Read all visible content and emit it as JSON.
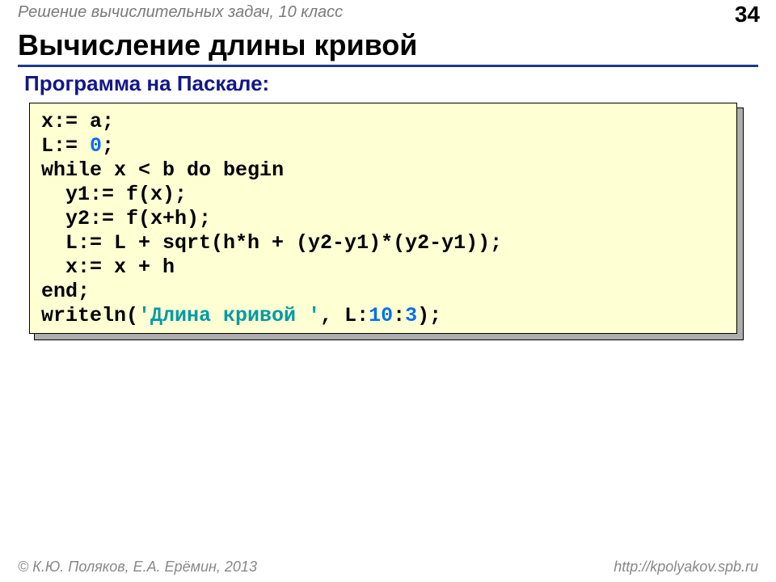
{
  "header": {
    "course": "Решение вычислительных задач, 10 класс",
    "page": "34"
  },
  "title": "Вычисление длины кривой",
  "subtitle": "Программа на Паскале:",
  "code": {
    "l1a": "x:= a;",
    "l2a": "L:= ",
    "l2b": "0",
    "l2c": ";",
    "l3a": "while",
    "l3b": " x < b ",
    "l3c": "do begin",
    "l4": "  y1:= f(x);",
    "l5": "  y2:= f(x+h);",
    "l6": "  L:= L + sqrt(h*h + (y2-y1)*(y2-y1));",
    "l7": "  x:= x + h",
    "l8": "end",
    "l8b": ";",
    "l9a": "writeln(",
    "l9b": "'Длина кривой '",
    "l9c": ", L:",
    "l9d": "10",
    "l9e": ":",
    "l9f": "3",
    "l9g": ");"
  },
  "footer": {
    "copyright": "© К.Ю. Поляков, Е.А. Ерёмин, 2013",
    "url": "http://kpolyakov.spb.ru"
  }
}
